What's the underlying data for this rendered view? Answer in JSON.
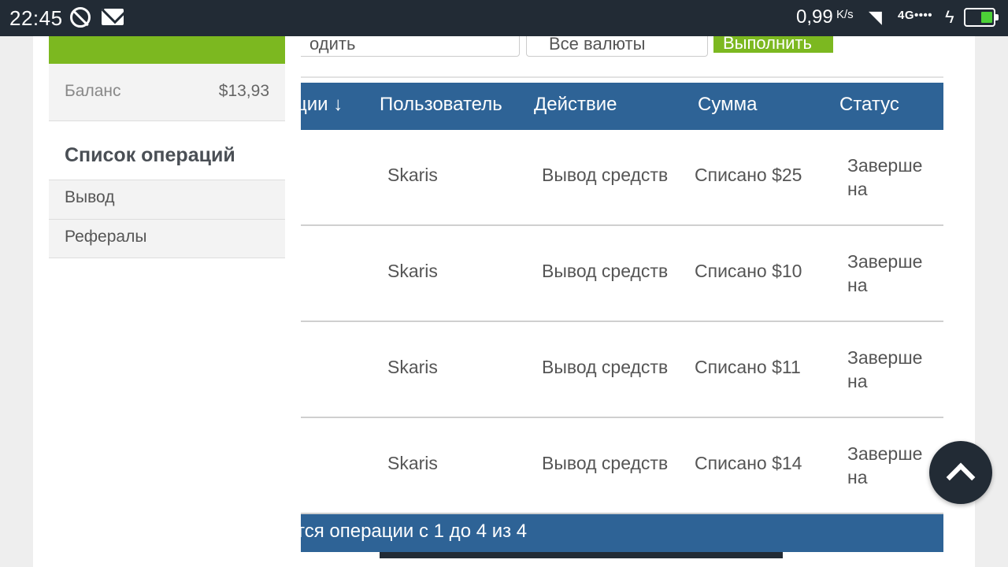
{
  "status_bar": {
    "time": "22:45",
    "speed": "0,99",
    "speed_unit": "K/s",
    "network": "4G••••"
  },
  "sidebar": {
    "balance_label": "Баланс",
    "balance_value": "$13,93",
    "section_title": "Список операций",
    "menu": [
      "Вывод",
      "Рефералы"
    ]
  },
  "filters": {
    "input_text": "одить",
    "select_text": "Все валюты",
    "button_label": "Выполнить"
  },
  "table": {
    "headers": [
      "ции ↓",
      "Пользователь",
      "Действие",
      "Сумма",
      "Статус"
    ],
    "rows": [
      {
        "user": "Skaris",
        "action": "Вывод средств",
        "amount": "Списано $25",
        "status": "Завершена"
      },
      {
        "user": "Skaris",
        "action": "Вывод средств",
        "amount": "Списано $10",
        "status": "Завершена"
      },
      {
        "user": "Skaris",
        "action": "Вывод средств",
        "amount": "Списано $11",
        "status": "Завершена"
      },
      {
        "user": "Skaris",
        "action": "Вывод средств",
        "amount": "Списано $14",
        "status": "Завершена"
      }
    ],
    "footer": "тся операции с 1 до 4 из 4"
  },
  "colors": {
    "brand_green": "#7cb820",
    "table_header": "#2e6396",
    "status_bar": "#222b35"
  }
}
